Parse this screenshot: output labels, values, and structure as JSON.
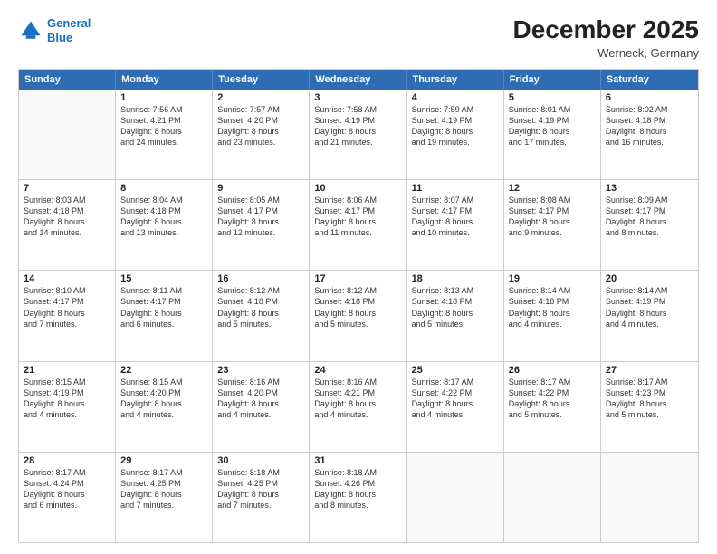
{
  "header": {
    "logo_line1": "General",
    "logo_line2": "Blue",
    "month": "December 2025",
    "location": "Werneck, Germany"
  },
  "weekdays": [
    "Sunday",
    "Monday",
    "Tuesday",
    "Wednesday",
    "Thursday",
    "Friday",
    "Saturday"
  ],
  "weeks": [
    [
      {
        "day": "",
        "info": ""
      },
      {
        "day": "1",
        "info": "Sunrise: 7:56 AM\nSunset: 4:21 PM\nDaylight: 8 hours\nand 24 minutes."
      },
      {
        "day": "2",
        "info": "Sunrise: 7:57 AM\nSunset: 4:20 PM\nDaylight: 8 hours\nand 23 minutes."
      },
      {
        "day": "3",
        "info": "Sunrise: 7:58 AM\nSunset: 4:19 PM\nDaylight: 8 hours\nand 21 minutes."
      },
      {
        "day": "4",
        "info": "Sunrise: 7:59 AM\nSunset: 4:19 PM\nDaylight: 8 hours\nand 19 minutes."
      },
      {
        "day": "5",
        "info": "Sunrise: 8:01 AM\nSunset: 4:19 PM\nDaylight: 8 hours\nand 17 minutes."
      },
      {
        "day": "6",
        "info": "Sunrise: 8:02 AM\nSunset: 4:18 PM\nDaylight: 8 hours\nand 16 minutes."
      }
    ],
    [
      {
        "day": "7",
        "info": "Sunrise: 8:03 AM\nSunset: 4:18 PM\nDaylight: 8 hours\nand 14 minutes."
      },
      {
        "day": "8",
        "info": "Sunrise: 8:04 AM\nSunset: 4:18 PM\nDaylight: 8 hours\nand 13 minutes."
      },
      {
        "day": "9",
        "info": "Sunrise: 8:05 AM\nSunset: 4:17 PM\nDaylight: 8 hours\nand 12 minutes."
      },
      {
        "day": "10",
        "info": "Sunrise: 8:06 AM\nSunset: 4:17 PM\nDaylight: 8 hours\nand 11 minutes."
      },
      {
        "day": "11",
        "info": "Sunrise: 8:07 AM\nSunset: 4:17 PM\nDaylight: 8 hours\nand 10 minutes."
      },
      {
        "day": "12",
        "info": "Sunrise: 8:08 AM\nSunset: 4:17 PM\nDaylight: 8 hours\nand 9 minutes."
      },
      {
        "day": "13",
        "info": "Sunrise: 8:09 AM\nSunset: 4:17 PM\nDaylight: 8 hours\nand 8 minutes."
      }
    ],
    [
      {
        "day": "14",
        "info": "Sunrise: 8:10 AM\nSunset: 4:17 PM\nDaylight: 8 hours\nand 7 minutes."
      },
      {
        "day": "15",
        "info": "Sunrise: 8:11 AM\nSunset: 4:17 PM\nDaylight: 8 hours\nand 6 minutes."
      },
      {
        "day": "16",
        "info": "Sunrise: 8:12 AM\nSunset: 4:18 PM\nDaylight: 8 hours\nand 5 minutes."
      },
      {
        "day": "17",
        "info": "Sunrise: 8:12 AM\nSunset: 4:18 PM\nDaylight: 8 hours\nand 5 minutes."
      },
      {
        "day": "18",
        "info": "Sunrise: 8:13 AM\nSunset: 4:18 PM\nDaylight: 8 hours\nand 5 minutes."
      },
      {
        "day": "19",
        "info": "Sunrise: 8:14 AM\nSunset: 4:18 PM\nDaylight: 8 hours\nand 4 minutes."
      },
      {
        "day": "20",
        "info": "Sunrise: 8:14 AM\nSunset: 4:19 PM\nDaylight: 8 hours\nand 4 minutes."
      }
    ],
    [
      {
        "day": "21",
        "info": "Sunrise: 8:15 AM\nSunset: 4:19 PM\nDaylight: 8 hours\nand 4 minutes."
      },
      {
        "day": "22",
        "info": "Sunrise: 8:15 AM\nSunset: 4:20 PM\nDaylight: 8 hours\nand 4 minutes."
      },
      {
        "day": "23",
        "info": "Sunrise: 8:16 AM\nSunset: 4:20 PM\nDaylight: 8 hours\nand 4 minutes."
      },
      {
        "day": "24",
        "info": "Sunrise: 8:16 AM\nSunset: 4:21 PM\nDaylight: 8 hours\nand 4 minutes."
      },
      {
        "day": "25",
        "info": "Sunrise: 8:17 AM\nSunset: 4:22 PM\nDaylight: 8 hours\nand 4 minutes."
      },
      {
        "day": "26",
        "info": "Sunrise: 8:17 AM\nSunset: 4:22 PM\nDaylight: 8 hours\nand 5 minutes."
      },
      {
        "day": "27",
        "info": "Sunrise: 8:17 AM\nSunset: 4:23 PM\nDaylight: 8 hours\nand 5 minutes."
      }
    ],
    [
      {
        "day": "28",
        "info": "Sunrise: 8:17 AM\nSunset: 4:24 PM\nDaylight: 8 hours\nand 6 minutes."
      },
      {
        "day": "29",
        "info": "Sunrise: 8:17 AM\nSunset: 4:25 PM\nDaylight: 8 hours\nand 7 minutes."
      },
      {
        "day": "30",
        "info": "Sunrise: 8:18 AM\nSunset: 4:25 PM\nDaylight: 8 hours\nand 7 minutes."
      },
      {
        "day": "31",
        "info": "Sunrise: 8:18 AM\nSunset: 4:26 PM\nDaylight: 8 hours\nand 8 minutes."
      },
      {
        "day": "",
        "info": ""
      },
      {
        "day": "",
        "info": ""
      },
      {
        "day": "",
        "info": ""
      }
    ]
  ]
}
